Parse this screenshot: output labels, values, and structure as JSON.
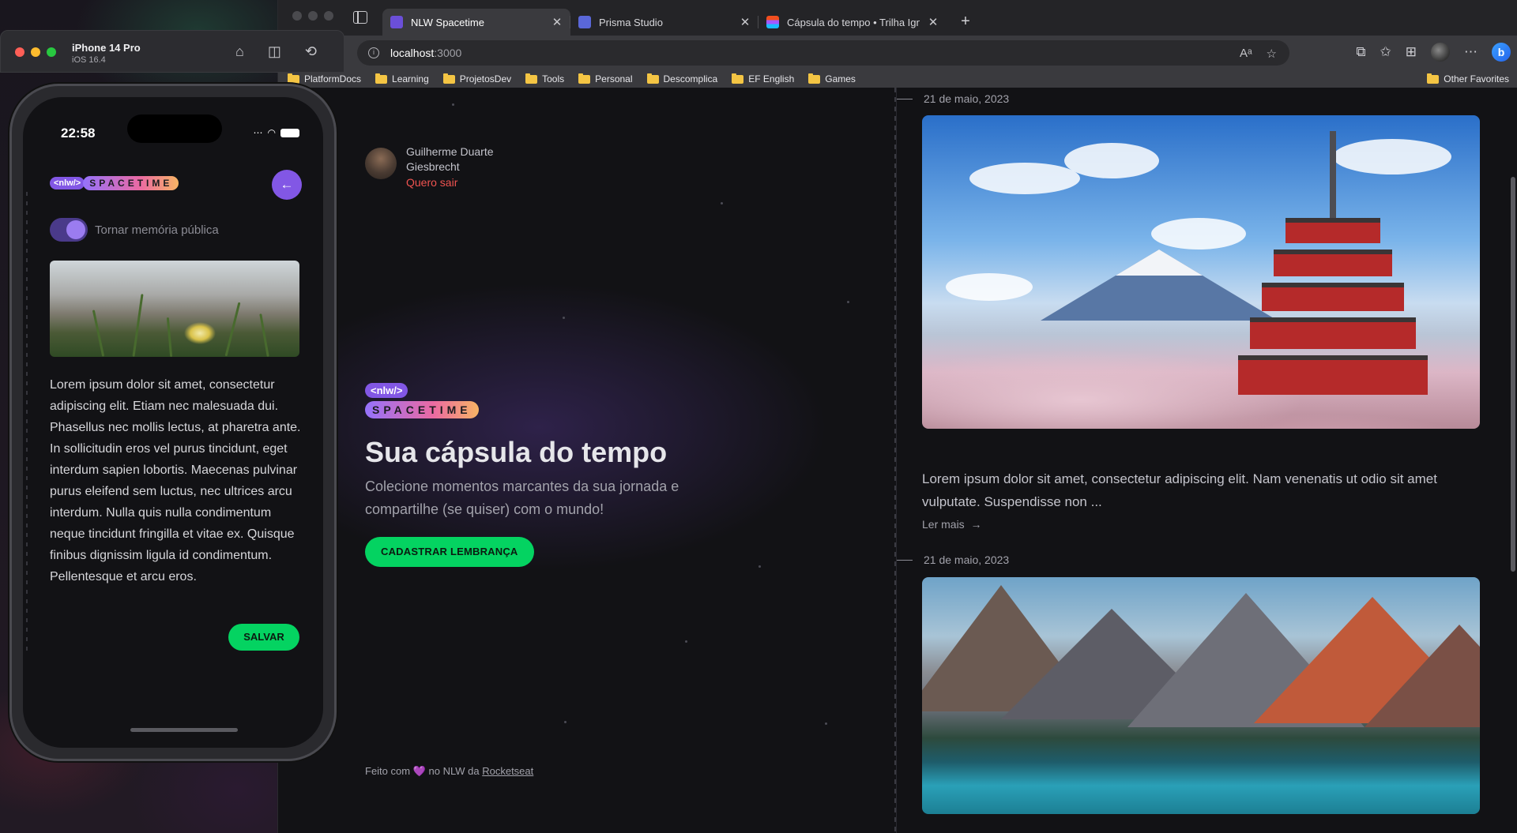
{
  "browser": {
    "tabs": [
      {
        "title": "NLW Spacetime",
        "favicon_color": "#6b4fd8",
        "active": true
      },
      {
        "title": "Prisma Studio",
        "favicon_color": "#5a67d8",
        "active": false
      },
      {
        "title": "Cápsula do tempo • Trilha Ignit",
        "favicon_color": "#f24e1e",
        "active": false
      }
    ],
    "address": {
      "host": "localhost",
      "port": ":3000"
    },
    "bookmarks": [
      "PlatformDocs",
      "Learning",
      "ProjetosDev",
      "Tools",
      "Personal",
      "Descomplica",
      "EF English",
      "Games"
    ],
    "other_favorites": "Other Favorites"
  },
  "web": {
    "profile": {
      "name": "Guilherme Duarte Giesbrecht",
      "logout": "Quero sair"
    },
    "logo": {
      "nlw": "<nlw/>",
      "spacetime": "SPACETIME"
    },
    "hero": {
      "title": "Sua cápsula do tempo",
      "subtitle": "Colecione momentos marcantes da sua jornada e compartilhe (se quiser) com o mundo!",
      "cta": "CADASTRAR LEMBRANÇA"
    },
    "footer": {
      "prefix": "Feito com",
      "heart": "💜",
      "middle": "no NLW da",
      "link": "Rocketseat"
    },
    "memories": [
      {
        "date": "21 de maio, 2023",
        "text": "Lorem ipsum dolor sit amet, consectetur adipiscing elit. Nam venenatis ut odio sit amet vulputate. Suspendisse non ...",
        "read_more": "Ler mais"
      },
      {
        "date": "21 de maio, 2023"
      }
    ]
  },
  "simulator": {
    "title": "iPhone 14 Pro",
    "subtitle": "iOS 16.4",
    "clock": "22:58",
    "app": {
      "logo_nlw": "<nlw/>",
      "logo_spacetime": "SPACETIME",
      "toggle_label": "Tornar memória pública",
      "toggle_on": true,
      "text": "Lorem ipsum dolor sit amet, consectetur adipiscing elit. Etiam nec malesuada dui. Phasellus nec mollis lectus, at pharetra ante. In sollicitudin eros vel purus tincidunt, eget interdum sapien lobortis. Maecenas pulvinar purus eleifend sem luctus, nec ultrices arcu interdum. Nulla quis nulla condimentum neque tincidunt fringilla et vitae ex. Quisque finibus dignissim ligula id condimentum. Pellentesque et arcu eros.",
      "save": "SALVAR"
    }
  },
  "colors": {
    "brand_purple": "#8257e5",
    "cta_green": "#04d361",
    "logout_red": "#ef5350",
    "background": "#121215"
  }
}
